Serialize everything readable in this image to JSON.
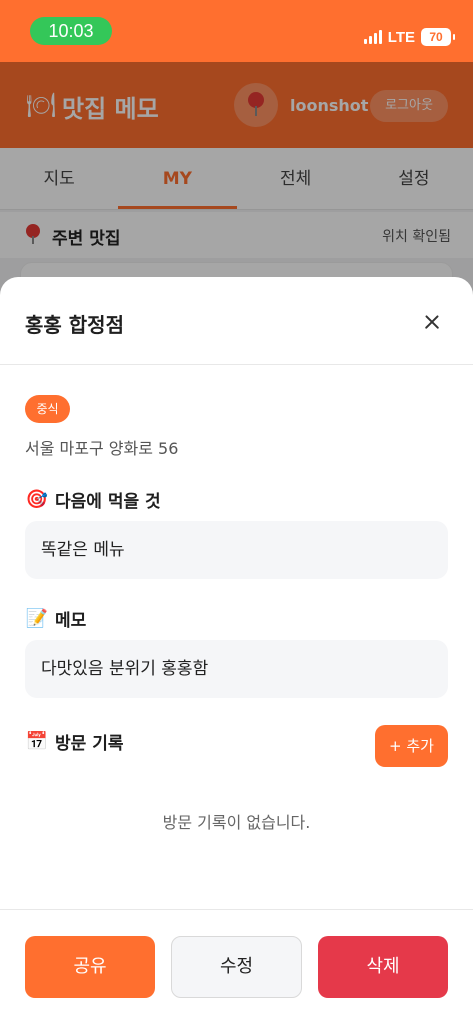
{
  "status_bar": {
    "time": "10:03",
    "network": "LTE",
    "battery": "70"
  },
  "app": {
    "logo_icon": "🍽",
    "title": "맛집 메모",
    "username": "loonshot",
    "logout_label": "로그아웃"
  },
  "tabs": [
    {
      "label": "지도"
    },
    {
      "label": "MY"
    },
    {
      "label": "전체"
    },
    {
      "label": "설정"
    }
  ],
  "nearby": {
    "title": "주변 맛집",
    "status": "위치 확인됨"
  },
  "sheet": {
    "title": "홍홍 합정점",
    "category": "중식",
    "address": "서울 마포구 양화로 56",
    "next_label": "다음에 먹을 것",
    "next_icon": "🎯",
    "next_value": "똑같은 메뉴",
    "memo_label": "메모",
    "memo_icon": "📝",
    "memo_value": "다맛있음 분위기 홍홍함",
    "visits_label": "방문 기록",
    "visits_icon": "📅",
    "add_label": "+ 추가",
    "empty_message": "방문 기록이 없습니다.",
    "actions": {
      "share": "공유",
      "edit": "수정",
      "delete": "삭제"
    }
  },
  "colors": {
    "accent": "#ff6f2f",
    "danger": "#e5394a",
    "status_pill": "#34c759"
  }
}
